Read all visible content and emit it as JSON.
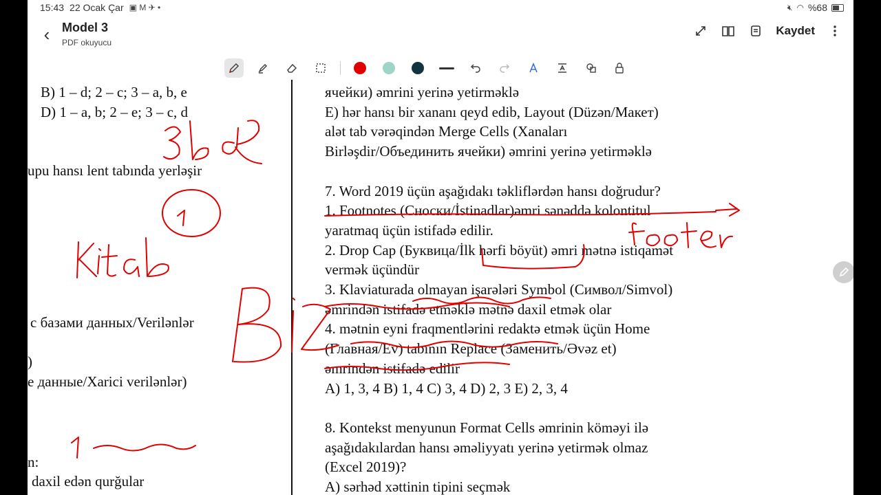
{
  "status": {
    "time": "15:43",
    "date": "22 Ocak Çar",
    "battery": "%68"
  },
  "app": {
    "title": "Model 3",
    "subtitle": "PDF okuyucu",
    "save_label": "Kaydet"
  },
  "toolbar": {
    "colors": [
      "#e00000",
      "#9fd4c8",
      "#12343f"
    ]
  },
  "left_column": [
    "B) 1 – d; 2 – c; 3 – a, b, e",
    "D) 1 – a, b; 2 – e; 3 – c, d",
    "upu hansı lent tabında yerləşir",
    "с базами данных/Verilənlər",
    ")",
    "е данные/Xarici verilənlər)",
    "n:",
    "daxil edən qurğular"
  ],
  "right_column": [
    "ячейки) əmrini yerinə yetirməklə",
    "E) hər hansı bir xananı qeyd edib, Layout (Düzən/Макет)",
    "alət tab vərəqindən Merge Cells (Xanaları",
    "Birləşdir/Объединить ячейки) əmrini yerinə yetirməklə",
    "7. Word 2019 üçün aşağıdakı təkliflərdən hansı doğrudur?",
    "1. Footnotes (Сноски/İstinadlar)əmri sənəddə kolontitul",
    "yaratmaq üçün istifadə edilir.",
    "2. Drop Cap (Буквица/İlk hərfi böyüt) əmri mətnə istiqamət",
    "vermək üçündür",
    "3. Klaviaturada olmayan işarələri Symbol (Символ/Simvol)",
    "əmrindən istifadə etməklə mətnə daxil etmək olar",
    "4. mətnin eyni fraqmentlərini redaktə etmək üçün Home",
    "(Главная/Ev) tabının Replace (Заменить/Əvəz et)",
    "əmrindən istifadə edilir",
    "A) 1, 3, 4  B) 1, 4   C) 3, 4  D) 2, 3       E) 2, 3, 4",
    "8. Kontekst menyunun Format Cells əmrinin köməyi ilə",
    "aşağıdakılardan hansı əməliyyatı yerinə yetirmək olmaz",
    "(Excel 2019)?",
    "A) sərhəd xəttinin tipini seçmək"
  ],
  "handwriting": [
    "3 bq",
    "1",
    "Kitab",
    "Biz",
    "footer",
    "1"
  ]
}
